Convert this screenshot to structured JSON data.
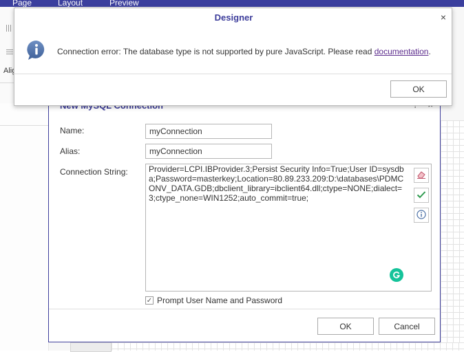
{
  "menu": {
    "items": [
      "Page",
      "Layout",
      "Preview"
    ]
  },
  "background": {
    "align_label": "Alig"
  },
  "connection_dialog": {
    "title": "New MySQL Connection",
    "name_label": "Name:",
    "name_value": "myConnection",
    "alias_label": "Alias:",
    "alias_value": "myConnection",
    "conn_string_label": "Connection String:",
    "conn_string_value": "Provider=LCPI.IBProvider.3;Persist Security Info=True;User ID=sysdba;Password=masterkey;Location=80.89.233.209:D:\\databases\\PDMCONV_DATA.GDB;dbclient_library=ibclient64.dll;ctype=NONE;dialect=3;ctype_none=WIN1252;auto_commit=true;",
    "prompt_checkbox_label": "Prompt User Name and Password",
    "prompt_checked": true,
    "ok_label": "OK",
    "cancel_label": "Cancel",
    "icons": {
      "clear": "eraser-icon",
      "test": "checkmark-icon",
      "info": "info-icon",
      "grammarly": "grammarly-icon"
    }
  },
  "error_dialog": {
    "title": "Designer",
    "close_glyph": "×",
    "message": "Connection error: The database type is not supported by pure JavaScript. Please read ",
    "link_text": "documentation",
    "message_end": ".",
    "ok_label": "OK",
    "icon": "info-bubble-icon"
  },
  "colors": {
    "accent": "#3d3d9b",
    "menu_bar": "#3b3f9e",
    "link": "#5b2b8c",
    "check_green": "#2e9a4e",
    "grammarly": "#15c39a",
    "info_icon": "#4a6fa5"
  }
}
